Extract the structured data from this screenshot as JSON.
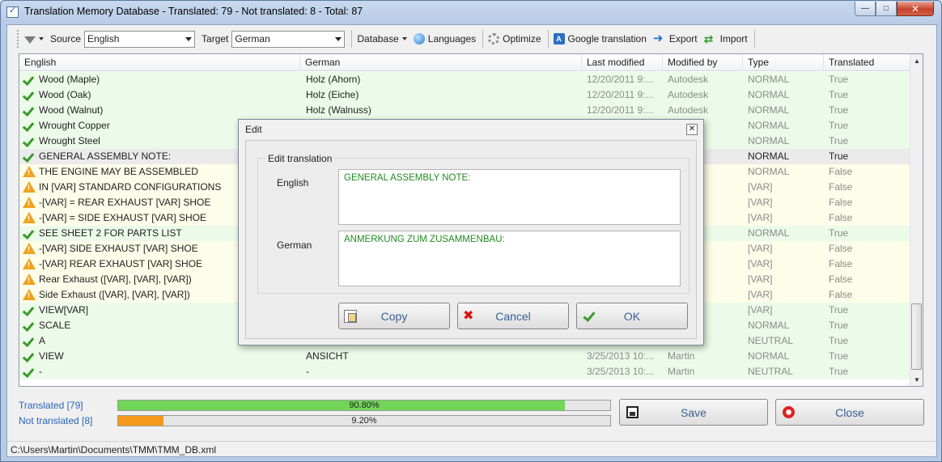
{
  "window": {
    "title": "Translation Memory Database - Translated: 79 - Not translated: 8 - Total: 87"
  },
  "toolbar": {
    "source_label": "Source",
    "source_value": "English",
    "target_label": "Target",
    "target_value": "German",
    "database_label": "Database",
    "languages_label": "Languages",
    "optimize_label": "Optimize",
    "google_label": "Google translation",
    "export_label": "Export",
    "import_label": "Import"
  },
  "grid": {
    "columns": [
      "English",
      "German",
      "Last modified",
      "Modified by",
      "Type",
      "Translated"
    ],
    "rows": [
      {
        "status": "ok",
        "english": "Wood (Maple)",
        "german": "Holz (Ahorn)",
        "modified": "12/20/2011 9:...",
        "by": "Autodesk",
        "type": "NORMAL",
        "translated": "True"
      },
      {
        "status": "ok",
        "english": "Wood (Oak)",
        "german": "Holz (Eiche)",
        "modified": "12/20/2011 9:...",
        "by": "Autodesk",
        "type": "NORMAL",
        "translated": "True"
      },
      {
        "status": "ok",
        "english": "Wood (Walnut)",
        "german": "Holz (Walnuss)",
        "modified": "12/20/2011 9:...",
        "by": "Autodesk",
        "type": "NORMAL",
        "translated": "True"
      },
      {
        "status": "ok",
        "english": "Wrought Copper",
        "german": "",
        "modified": "",
        "by": "",
        "type": "NORMAL",
        "translated": "True"
      },
      {
        "status": "ok",
        "english": "Wrought Steel",
        "german": "",
        "modified": "",
        "by": "",
        "type": "NORMAL",
        "translated": "True"
      },
      {
        "status": "sel",
        "english": "GENERAL ASSEMBLY NOTE:",
        "german": "",
        "modified": "",
        "by": "",
        "type": "NORMAL",
        "translated": "True"
      },
      {
        "status": "warn",
        "english": "THE ENGINE MAY BE ASSEMBLED",
        "german": "",
        "modified": "",
        "by": "",
        "type": "NORMAL",
        "translated": "False"
      },
      {
        "status": "warn",
        "english": "IN [VAR]  STANDARD CONFIGURATIONS",
        "german": "",
        "modified": "",
        "by": "",
        "type": "[VAR]",
        "translated": "False"
      },
      {
        "status": "warn",
        "english": "-[VAR] = REAR EXHAUST [VAR] SHOE",
        "german": "",
        "modified": "",
        "by": "",
        "type": "[VAR]",
        "translated": "False"
      },
      {
        "status": "warn",
        "english": "-[VAR] = SIDE EXHAUST [VAR] SHOE",
        "german": "",
        "modified": "",
        "by": "",
        "type": "[VAR]",
        "translated": "False"
      },
      {
        "status": "ok",
        "english": "SEE SHEET 2 FOR PARTS LIST",
        "german": "",
        "modified": "",
        "by": "",
        "type": "NORMAL",
        "translated": "True"
      },
      {
        "status": "warn",
        "english": "-[VAR] SIDE EXHAUST [VAR] SHOE",
        "german": "",
        "modified": "",
        "by": "",
        "type": "[VAR]",
        "translated": "False"
      },
      {
        "status": "warn",
        "english": "-[VAR] REAR EXHAUST [VAR] SHOE",
        "german": "",
        "modified": "",
        "by": "",
        "type": "[VAR]",
        "translated": "False"
      },
      {
        "status": "warn",
        "english": "Rear Exhaust ([VAR], [VAR], [VAR])",
        "german": "",
        "modified": "",
        "by": "",
        "type": "[VAR]",
        "translated": "False"
      },
      {
        "status": "warn",
        "english": "Side Exhaust ([VAR], [VAR], [VAR])",
        "german": "",
        "modified": "",
        "by": "",
        "type": "[VAR]",
        "translated": "False"
      },
      {
        "status": "ok",
        "english": "VIEW[VAR]",
        "german": "",
        "modified": "",
        "by": "",
        "type": "[VAR]",
        "translated": "True"
      },
      {
        "status": "ok",
        "english": "SCALE",
        "german": "",
        "modified": "",
        "by": "",
        "type": "NORMAL",
        "translated": "True"
      },
      {
        "status": "ok",
        "english": "A",
        "german": "",
        "modified": "",
        "by": "",
        "type": "NEUTRAL",
        "translated": "True"
      },
      {
        "status": "ok",
        "english": "VIEW",
        "german": "ANSICHT",
        "modified": "3/25/2013 10:...",
        "by": "Martin",
        "type": "NORMAL",
        "translated": "True"
      },
      {
        "status": "ok",
        "english": "-",
        "german": "-",
        "modified": "3/25/2013 10:...",
        "by": "Martin",
        "type": "NEUTRAL",
        "translated": "True"
      }
    ]
  },
  "stats": {
    "translated_label": "Translated [79]",
    "translated_pct": "90.80%",
    "translated_fraction": 0.908,
    "not_translated_label": "Not translated [8]",
    "not_translated_pct": "9.20%",
    "not_translated_fraction": 0.092
  },
  "buttons": {
    "save": "Save",
    "close": "Close"
  },
  "statusbar": {
    "path": "C:\\Users\\Martin\\Documents\\TMM\\TMM_DB.xml"
  },
  "dialog": {
    "title": "Edit",
    "group_label": "Edit translation",
    "english_label": "English",
    "english_text": "GENERAL ASSEMBLY NOTE:",
    "german_label": "German",
    "german_text": "ANMERKUNG ZUM ZUSAMMENBAU:",
    "copy_label": "Copy",
    "cancel_label": "Cancel",
    "ok_label": "OK"
  },
  "colors": {
    "translated_bar": "#6fd658",
    "not_translated_bar": "#f59a1c",
    "row_ok": "#ecfbe9",
    "row_warn": "#fdfde9",
    "link_blue": "#2a64b6"
  }
}
